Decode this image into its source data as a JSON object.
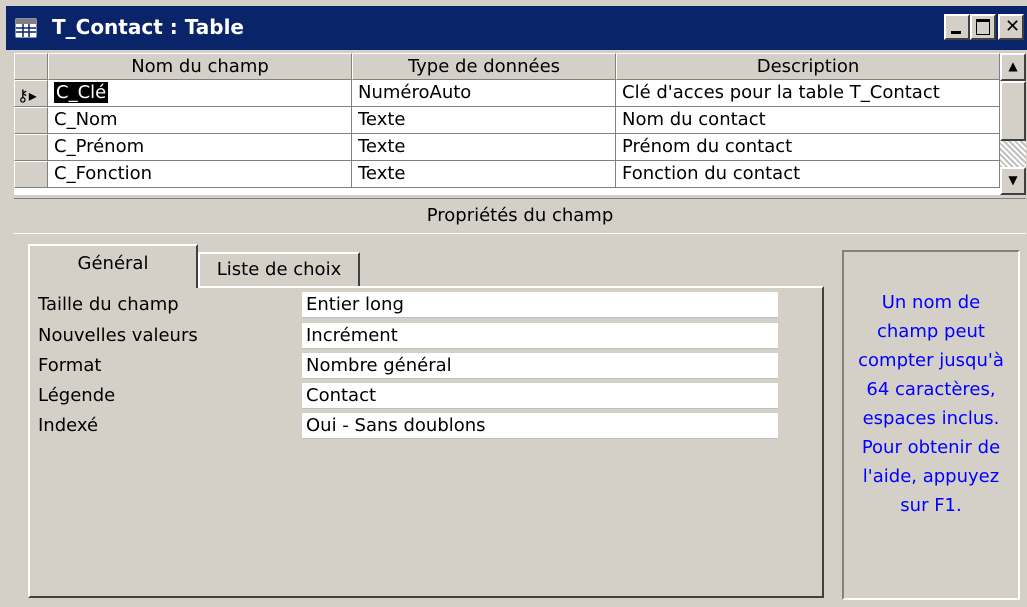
{
  "window": {
    "title": "T_Contact : Table",
    "close_glyph": "✕"
  },
  "grid": {
    "headers": {
      "name": "Nom du champ",
      "type": "Type de données",
      "desc": "Description"
    },
    "rows": [
      {
        "name": "C_Clé",
        "type": "NuméroAuto",
        "desc": "Clé d'acces pour la table T_Contact",
        "primary_key": true
      },
      {
        "name": "C_Nom",
        "type": "Texte",
        "desc": "Nom du contact"
      },
      {
        "name": "C_Prénom",
        "type": "Texte",
        "desc": "Prénom du contact"
      },
      {
        "name": "C_Fonction",
        "type": "Texte",
        "desc": "Fonction du contact"
      }
    ],
    "selector_glyph": "⚷▸"
  },
  "section_title": "Propriétés du champ",
  "tabs": {
    "general": "Général",
    "lookup": "Liste de choix"
  },
  "properties": [
    {
      "label": "Taille du champ",
      "value": "Entier long"
    },
    {
      "label": "Nouvelles valeurs",
      "value": "Incrément"
    },
    {
      "label": "Format",
      "value": "Nombre général"
    },
    {
      "label": "Légende",
      "value": "Contact"
    },
    {
      "label": "Indexé",
      "value": "Oui - Sans doublons"
    }
  ],
  "help_text": "Un nom de champ peut compter jusqu'à 64 caractères, espaces inclus. Pour obtenir de l'aide, appuyez sur F1.",
  "colors": {
    "titlebar": "#0a246a",
    "help_text": "#0000ff",
    "face": "#d4d0c8"
  }
}
